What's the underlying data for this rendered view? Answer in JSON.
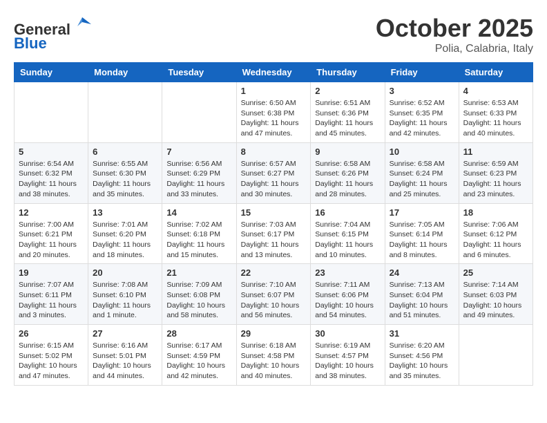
{
  "header": {
    "logo_line1": "General",
    "logo_line2": "Blue",
    "month": "October 2025",
    "location": "Polia, Calabria, Italy"
  },
  "days_of_week": [
    "Sunday",
    "Monday",
    "Tuesday",
    "Wednesday",
    "Thursday",
    "Friday",
    "Saturday"
  ],
  "weeks": [
    [
      {
        "day": "",
        "info": ""
      },
      {
        "day": "",
        "info": ""
      },
      {
        "day": "",
        "info": ""
      },
      {
        "day": "1",
        "info": "Sunrise: 6:50 AM\nSunset: 6:38 PM\nDaylight: 11 hours\nand 47 minutes."
      },
      {
        "day": "2",
        "info": "Sunrise: 6:51 AM\nSunset: 6:36 PM\nDaylight: 11 hours\nand 45 minutes."
      },
      {
        "day": "3",
        "info": "Sunrise: 6:52 AM\nSunset: 6:35 PM\nDaylight: 11 hours\nand 42 minutes."
      },
      {
        "day": "4",
        "info": "Sunrise: 6:53 AM\nSunset: 6:33 PM\nDaylight: 11 hours\nand 40 minutes."
      }
    ],
    [
      {
        "day": "5",
        "info": "Sunrise: 6:54 AM\nSunset: 6:32 PM\nDaylight: 11 hours\nand 38 minutes."
      },
      {
        "day": "6",
        "info": "Sunrise: 6:55 AM\nSunset: 6:30 PM\nDaylight: 11 hours\nand 35 minutes."
      },
      {
        "day": "7",
        "info": "Sunrise: 6:56 AM\nSunset: 6:29 PM\nDaylight: 11 hours\nand 33 minutes."
      },
      {
        "day": "8",
        "info": "Sunrise: 6:57 AM\nSunset: 6:27 PM\nDaylight: 11 hours\nand 30 minutes."
      },
      {
        "day": "9",
        "info": "Sunrise: 6:58 AM\nSunset: 6:26 PM\nDaylight: 11 hours\nand 28 minutes."
      },
      {
        "day": "10",
        "info": "Sunrise: 6:58 AM\nSunset: 6:24 PM\nDaylight: 11 hours\nand 25 minutes."
      },
      {
        "day": "11",
        "info": "Sunrise: 6:59 AM\nSunset: 6:23 PM\nDaylight: 11 hours\nand 23 minutes."
      }
    ],
    [
      {
        "day": "12",
        "info": "Sunrise: 7:00 AM\nSunset: 6:21 PM\nDaylight: 11 hours\nand 20 minutes."
      },
      {
        "day": "13",
        "info": "Sunrise: 7:01 AM\nSunset: 6:20 PM\nDaylight: 11 hours\nand 18 minutes."
      },
      {
        "day": "14",
        "info": "Sunrise: 7:02 AM\nSunset: 6:18 PM\nDaylight: 11 hours\nand 15 minutes."
      },
      {
        "day": "15",
        "info": "Sunrise: 7:03 AM\nSunset: 6:17 PM\nDaylight: 11 hours\nand 13 minutes."
      },
      {
        "day": "16",
        "info": "Sunrise: 7:04 AM\nSunset: 6:15 PM\nDaylight: 11 hours\nand 10 minutes."
      },
      {
        "day": "17",
        "info": "Sunrise: 7:05 AM\nSunset: 6:14 PM\nDaylight: 11 hours\nand 8 minutes."
      },
      {
        "day": "18",
        "info": "Sunrise: 7:06 AM\nSunset: 6:12 PM\nDaylight: 11 hours\nand 6 minutes."
      }
    ],
    [
      {
        "day": "19",
        "info": "Sunrise: 7:07 AM\nSunset: 6:11 PM\nDaylight: 11 hours\nand 3 minutes."
      },
      {
        "day": "20",
        "info": "Sunrise: 7:08 AM\nSunset: 6:10 PM\nDaylight: 11 hours\nand 1 minute."
      },
      {
        "day": "21",
        "info": "Sunrise: 7:09 AM\nSunset: 6:08 PM\nDaylight: 10 hours\nand 58 minutes."
      },
      {
        "day": "22",
        "info": "Sunrise: 7:10 AM\nSunset: 6:07 PM\nDaylight: 10 hours\nand 56 minutes."
      },
      {
        "day": "23",
        "info": "Sunrise: 7:11 AM\nSunset: 6:06 PM\nDaylight: 10 hours\nand 54 minutes."
      },
      {
        "day": "24",
        "info": "Sunrise: 7:13 AM\nSunset: 6:04 PM\nDaylight: 10 hours\nand 51 minutes."
      },
      {
        "day": "25",
        "info": "Sunrise: 7:14 AM\nSunset: 6:03 PM\nDaylight: 10 hours\nand 49 minutes."
      }
    ],
    [
      {
        "day": "26",
        "info": "Sunrise: 6:15 AM\nSunset: 5:02 PM\nDaylight: 10 hours\nand 47 minutes."
      },
      {
        "day": "27",
        "info": "Sunrise: 6:16 AM\nSunset: 5:01 PM\nDaylight: 10 hours\nand 44 minutes."
      },
      {
        "day": "28",
        "info": "Sunrise: 6:17 AM\nSunset: 4:59 PM\nDaylight: 10 hours\nand 42 minutes."
      },
      {
        "day": "29",
        "info": "Sunrise: 6:18 AM\nSunset: 4:58 PM\nDaylight: 10 hours\nand 40 minutes."
      },
      {
        "day": "30",
        "info": "Sunrise: 6:19 AM\nSunset: 4:57 PM\nDaylight: 10 hours\nand 38 minutes."
      },
      {
        "day": "31",
        "info": "Sunrise: 6:20 AM\nSunset: 4:56 PM\nDaylight: 10 hours\nand 35 minutes."
      },
      {
        "day": "",
        "info": ""
      }
    ]
  ]
}
